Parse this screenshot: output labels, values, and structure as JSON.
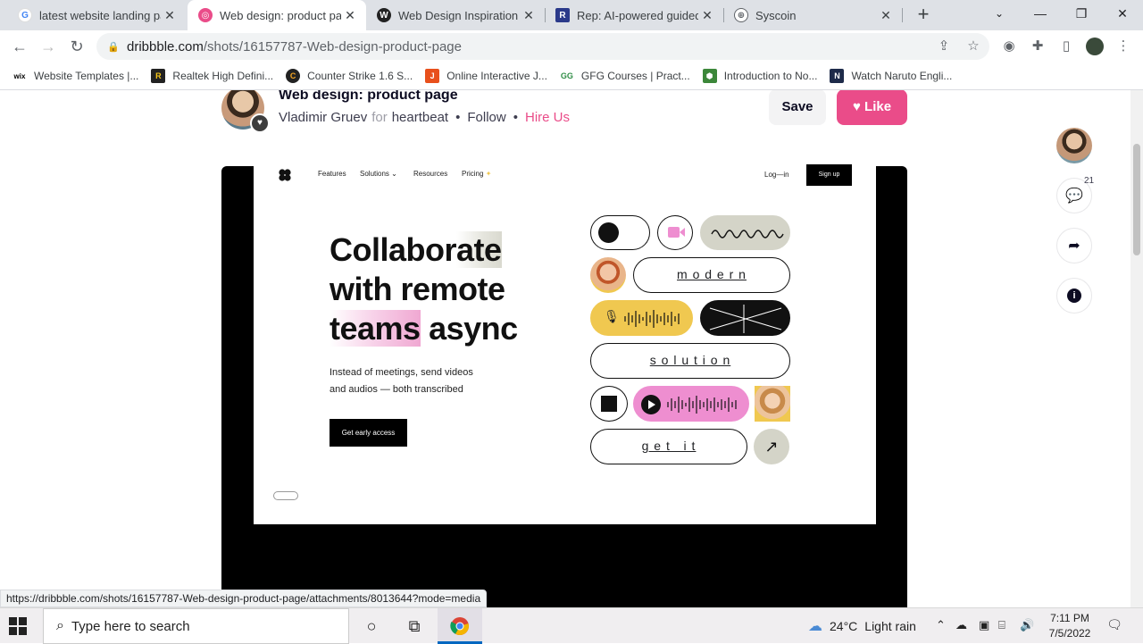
{
  "browser": {
    "tabs": [
      {
        "title": "latest website landing page",
        "favicon": "google-icon",
        "active": false
      },
      {
        "title": "Web design: product page",
        "favicon": "dribbble-icon",
        "active": true
      },
      {
        "title": "Web Design Inspiration : T",
        "favicon": "webflow-icon",
        "active": false
      },
      {
        "title": "Rep: AI-powered guided s",
        "favicon": "rep-icon",
        "active": false
      },
      {
        "title": "Syscoin",
        "favicon": "globe-icon",
        "active": false
      }
    ],
    "url_host": "dribbble.com",
    "url_path": "/shots/16157787-Web-design-product-page",
    "bookmarks": [
      {
        "label": "Website Templates |...",
        "icon": "wix-icon"
      },
      {
        "label": "Realtek High Defini...",
        "icon": "realtek-icon"
      },
      {
        "label": "Counter Strike 1.6 S...",
        "icon": "cs-icon"
      },
      {
        "label": "Online Interactive J...",
        "icon": "js-icon"
      },
      {
        "label": "GFG Courses | Pract...",
        "icon": "gfg-icon"
      },
      {
        "label": "Introduction to No...",
        "icon": "node-icon"
      },
      {
        "label": "Watch Naruto Engli...",
        "icon": "naruto-icon"
      }
    ],
    "status_url": "https://dribbble.com/shots/16157787-Web-design-product-page/attachments/8013644?mode=media"
  },
  "shot": {
    "title": "Web design: product page",
    "author": "Vladimir Gruev",
    "for_word": "for",
    "team": "heartbeat",
    "follow": "Follow",
    "hire": "Hire Us",
    "save": "Save",
    "like": "Like",
    "comment_count": "21"
  },
  "mockup": {
    "nav": [
      "Features",
      "Solutions",
      "Resources",
      "Pricing"
    ],
    "login": "Log—in",
    "signup": "Sign up",
    "hero_line1a": "Collabor",
    "hero_line1b": "ate",
    "hero_line2": "with remote",
    "hero_line3a": "teams",
    "hero_line3b": " async",
    "sub_line1": "Instead of meetings, send videos",
    "sub_line2": "and audios — both transcribed",
    "cta": "Get early access",
    "pill_modern": "m o d e r n",
    "pill_solution": "s o l u t i o n",
    "pill_getit": "g e t   i t"
  },
  "taskbar": {
    "search_placeholder": "Type here to search",
    "temp": "24°C",
    "weather": "Light rain",
    "time": "7:11 PM",
    "date": "7/5/2022"
  },
  "colors": {
    "dribbble_pink": "#ea4c89",
    "mock_yellow": "#f0c850",
    "mock_pink": "#ee8ed0",
    "mock_sage": "#d4d4c8"
  }
}
